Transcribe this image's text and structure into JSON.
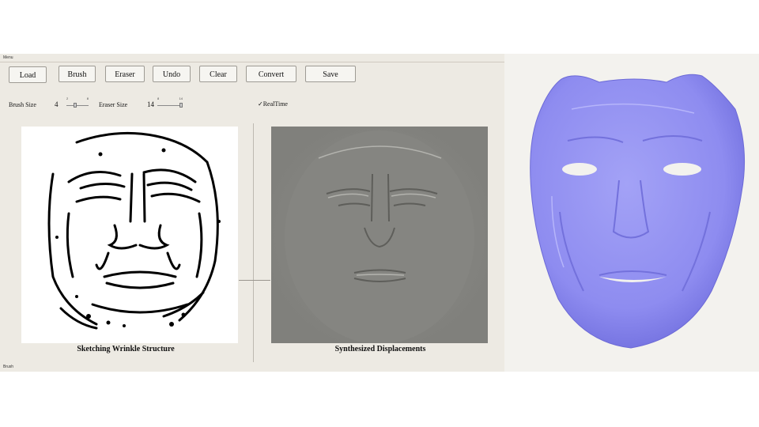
{
  "menu": {
    "label": "Menu"
  },
  "toolbar": {
    "buttons": [
      "Load",
      "Brush",
      "Eraser",
      "Undo",
      "Clear",
      "Convert",
      "Save"
    ]
  },
  "controls": {
    "brush_size_label": "Brush Size",
    "brush_size_value": "4",
    "brush_slider": {
      "min": "2",
      "max": "8",
      "value": 4
    },
    "eraser_size_label": "Eraser Size",
    "eraser_size_value": "14",
    "eraser_slider": {
      "min": "8",
      "max": "14",
      "value": 14
    },
    "realtime_label": "RealTime",
    "realtime_checked": true
  },
  "panels": {
    "left_caption": "Sketching Wrinkle Structure",
    "right_caption": "Synthesized Displacements"
  },
  "status": {
    "text": "Brush"
  },
  "colors": {
    "face_mesh": "#8f8ef0",
    "app_bg": "#edeae3",
    "displacement_bg": "#8a8a86"
  }
}
